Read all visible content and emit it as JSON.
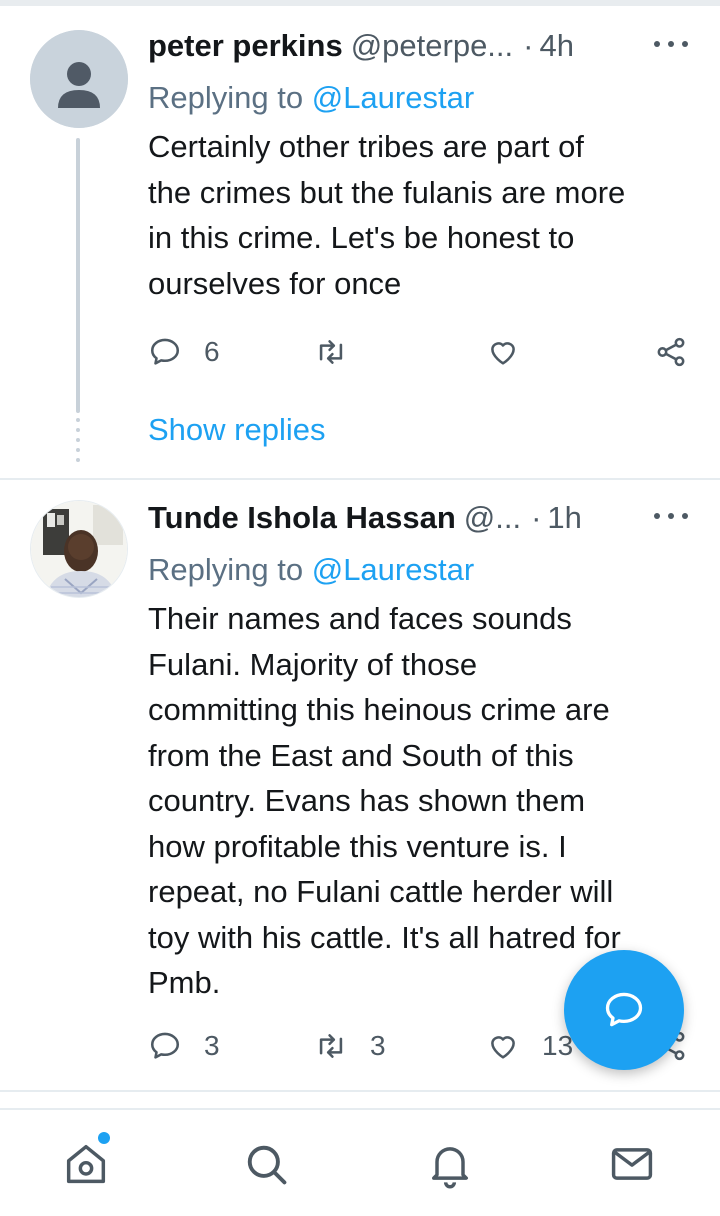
{
  "tweets": [
    {
      "name": "peter perkins",
      "handle": "@peterpe...",
      "separator": "·",
      "time": "4h",
      "replying_prefix": "Replying to ",
      "replying_to": "@Laurestar",
      "text": "Certainly other tribes are part of\nthe crimes but the fulanis are more\nin this crime. Let's be honest to\nourselves for once",
      "reply_count": "6",
      "retweet_count": "",
      "like_count": "",
      "show_replies": "Show replies"
    },
    {
      "name": "Tunde Ishola Hassan",
      "handle": "@...",
      "separator": "·",
      "time": "1h",
      "replying_prefix": "Replying to ",
      "replying_to": "@Laurestar",
      "text": "Their names and faces sounds\nFulani. Majority of those\ncommitting this heinous crime are\nfrom the East and South of this\ncountry. Evans has shown them\nhow profitable this venture is. I\nrepeat, no Fulani cattle herder will\ntoy with his cattle. It's all hatred for\nPmb.",
      "reply_count": "3",
      "retweet_count": "3",
      "like_count": "13"
    }
  ],
  "icons": {
    "reply": "reply-icon",
    "retweet": "retweet-icon",
    "like": "heart-icon",
    "share": "share-icon",
    "more": "more-icon",
    "compose": "compose-reply-icon",
    "nav": [
      "home-icon",
      "search-icon",
      "notifications-icon",
      "messages-icon"
    ]
  },
  "colors": {
    "accent": "#1da1f2",
    "text": "#14171a",
    "secondary": "#5b7083",
    "divider": "#e6ecf0"
  }
}
